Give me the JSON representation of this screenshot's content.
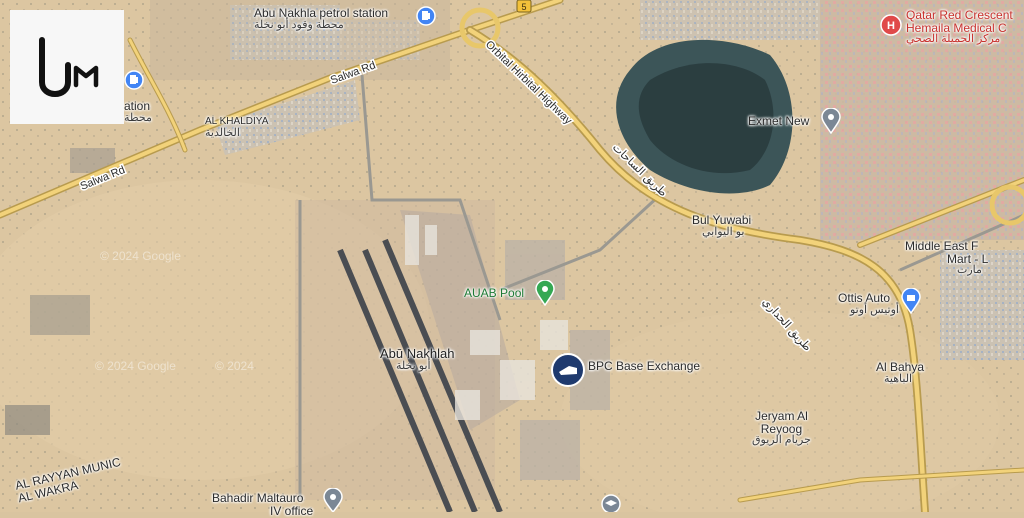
{
  "logo": {
    "icon": "um-logo"
  },
  "road_shields": {
    "shield_5": "5"
  },
  "places": {
    "abu_nakhla_petrol": {
      "name": "Abu Nakhla petrol station",
      "name_ar": "محطة وقود أبو نخلة"
    },
    "station_left": {
      "name": "ation",
      "name_ar": "محطة"
    },
    "qatar_red_crescent": {
      "name": "Qatar Red Crescent",
      "name2": "Hemaila Medical C",
      "name_ar": "مركز الحميلة الصحي"
    },
    "exmet_new": {
      "name": "Exmet New"
    },
    "al_khaldiya": {
      "name": "AL KHALDIYA",
      "name_ar": "الخالدية"
    },
    "bul_yuwabi": {
      "name": "Bul Yuwabi",
      "name_ar": "بو اليوابي"
    },
    "middle_east_mart": {
      "name": "Middle East F",
      "name2": "Mart - L",
      "name_ar": "مارت"
    },
    "ottis_auto": {
      "name": "Ottis Auto",
      "name_ar": "أوتيس أوتو"
    },
    "auab_pool": {
      "name": "AUAB Pool"
    },
    "abu_nakhlah": {
      "name": "Abū Nakhlah",
      "name_ar": "أبو نخلة"
    },
    "bpc_base_exchange": {
      "name": "BPC Base Exchange"
    },
    "al_bahya": {
      "name": "Al Bahya",
      "name_ar": "الباهية"
    },
    "jeryam_al_reyoog": {
      "name": "Jeryam Al",
      "name2": "Reyoog",
      "name_ar": "جريام الريوق"
    },
    "bahadir": {
      "name": "Bahadir Maltauro",
      "name2": "IV office"
    },
    "al_rayyan": {
      "name": "AL RAYYAN MUNIC",
      "name2": "AL WAKRA"
    }
  },
  "roads": {
    "salwa_rd_1": "Salwa Rd",
    "salwa_rd_2": "Salwa Rd",
    "orbital_highway": "Orbital Hirbital Highway",
    "orbital_ar_1": "طريق الساحات",
    "orbital_ar_2": "طريق الحداري"
  },
  "watermarks": {
    "w1": "© 2024 Google",
    "w2": "© 2024 Google",
    "w3": "© 2024"
  },
  "colors": {
    "desert": "#d9c4a0",
    "road_yellow": "#f2d27a",
    "wetland": "#2f4a4e",
    "red_crescent": "#e04a4a",
    "base_blue": "#1f3a6e",
    "pin_grey": "#7b8795",
    "pin_green": "#34a853",
    "pin_blue": "#4285f4"
  }
}
